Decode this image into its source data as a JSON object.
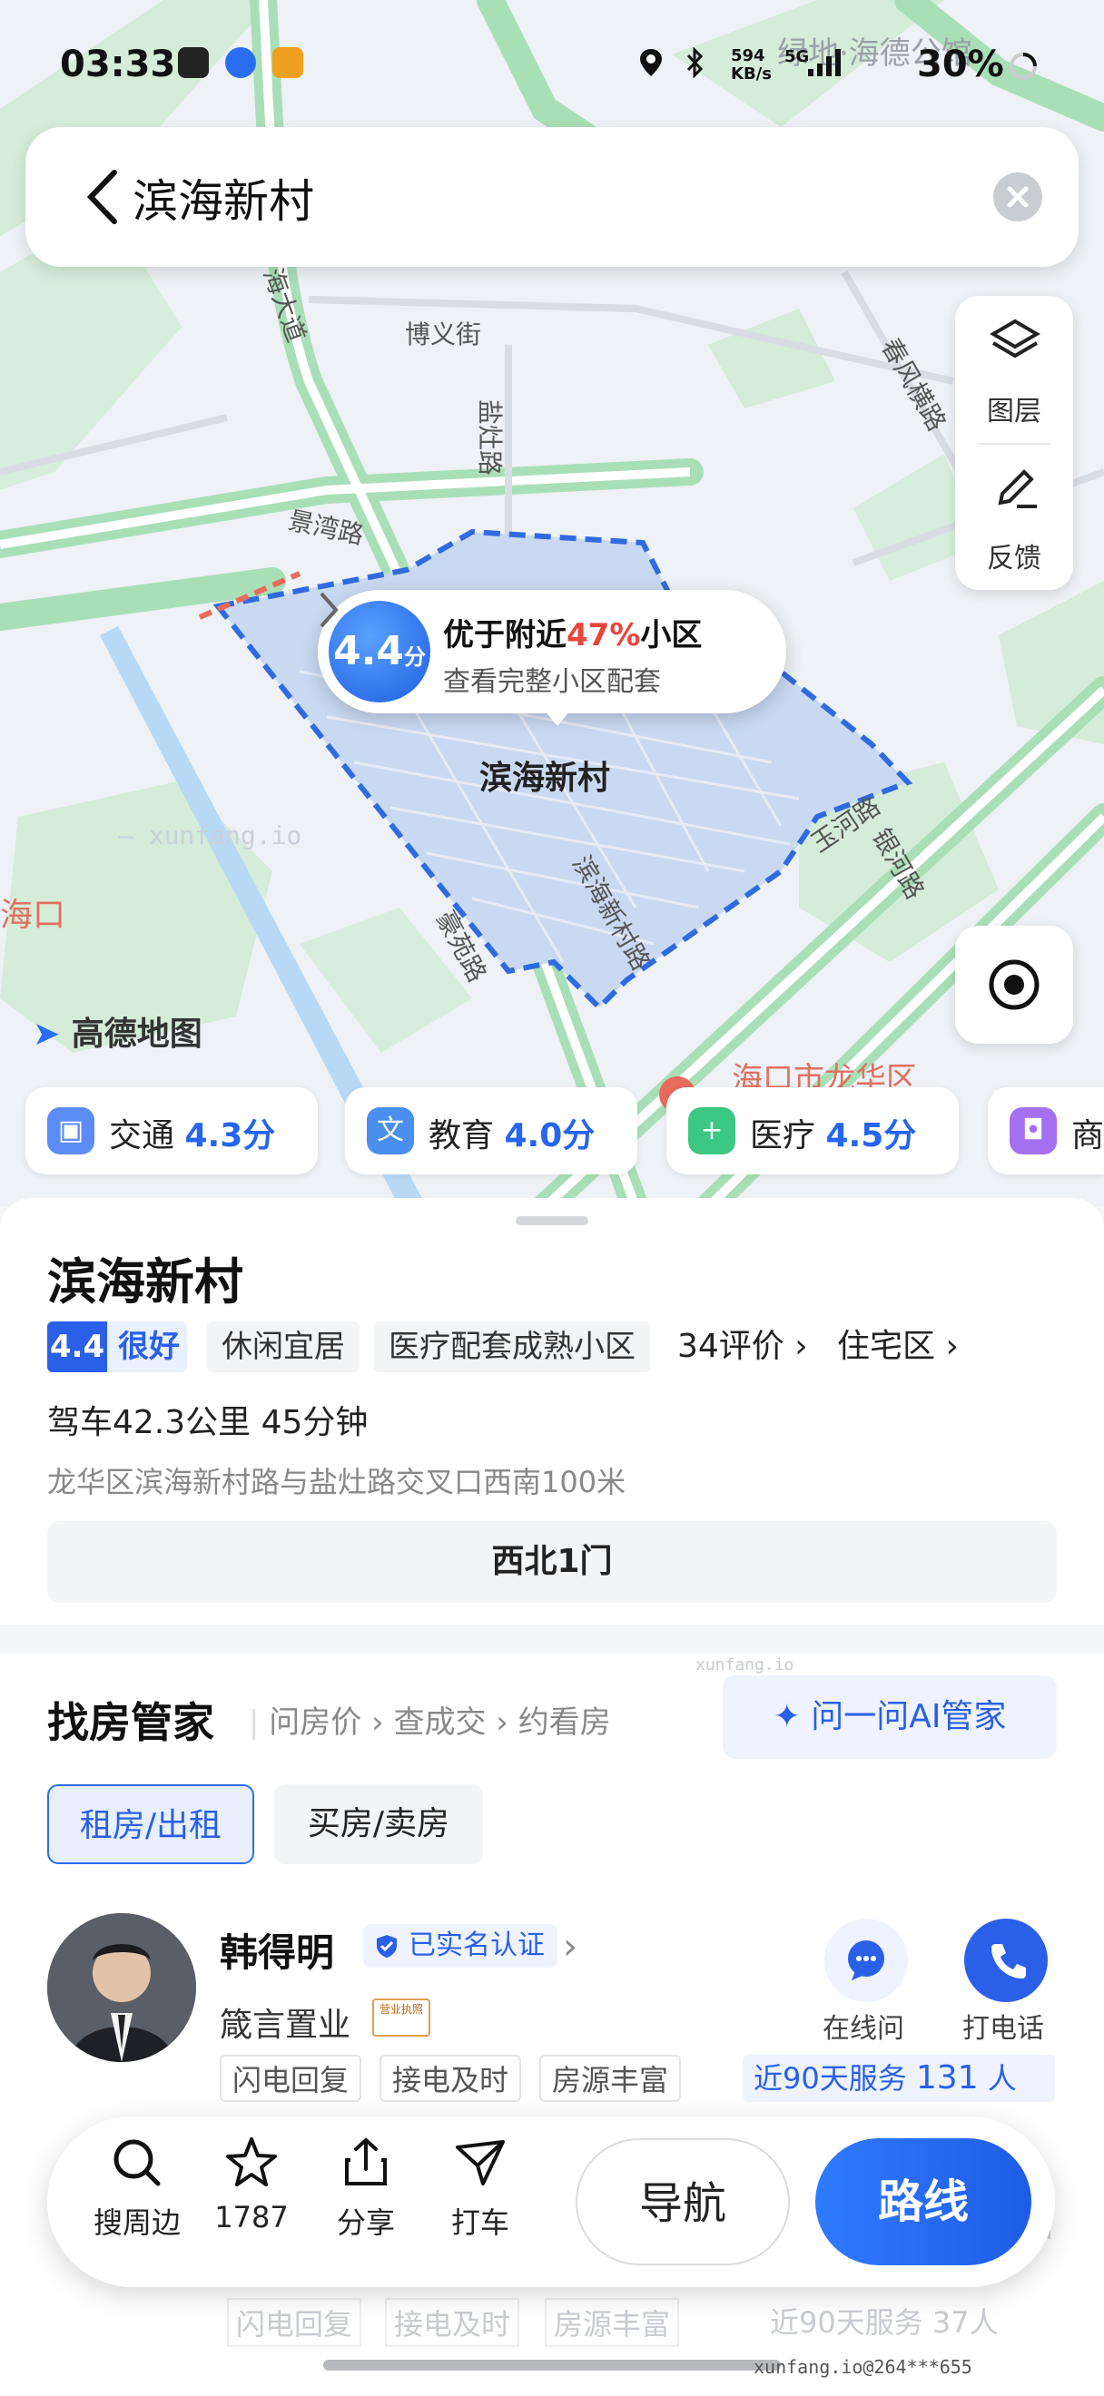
{
  "status_bar": {
    "time": "03:33",
    "net_speed": "594",
    "net_unit": "KB/s",
    "signal": "5G",
    "battery": "30%"
  },
  "search": {
    "title": "滨海新村"
  },
  "map": {
    "tools": {
      "layers_label": "图层",
      "feedback_label": "反馈"
    },
    "bubble": {
      "score": "4.4",
      "score_unit": "分",
      "prefix": "优于附近",
      "percent": "47%",
      "suffix": "小区",
      "subtitle": "查看完整小区配套"
    },
    "area_label": "滨海新村",
    "streets": [
      "博义街",
      "盐灶路",
      "景湾路",
      "春风横路",
      "滨海新村路",
      "豪苑路",
      "玉河路",
      "银河路",
      "海大道"
    ],
    "place_labels": [
      "绿地·海德公馆",
      "海口",
      "海口市龙华区"
    ],
    "watermark": "xunfang.io",
    "logo": "高德地图"
  },
  "chips": [
    {
      "icon": "train-icon",
      "label": "交通",
      "score": "4.3分",
      "color": "#5b8cf5"
    },
    {
      "icon": "education-icon",
      "label": "教育",
      "score": "4.0分",
      "color": "#4a8ef0"
    },
    {
      "icon": "medical-icon",
      "label": "医疗",
      "score": "4.5分",
      "color": "#3cc783"
    },
    {
      "icon": "shop-icon",
      "label": "商",
      "score": "",
      "color": "#a470f0"
    }
  ],
  "place": {
    "name": "滨海新村",
    "rating": "4.4",
    "rating_word": "很好",
    "tags": [
      "休闲宜居",
      "医疗配套成熟小区"
    ],
    "reviews": "34评价",
    "type": "住宅区",
    "drive": "驾车42.3公里 45分钟",
    "address": "龙华区滨海新村路与盐灶路交叉口西南100米",
    "gate": "西北1门"
  },
  "agent_section": {
    "title": "找房管家",
    "steps": [
      "问房价",
      "查成交",
      "约看房"
    ],
    "ai_button": "问一问AI管家",
    "tabs": [
      "租房/出租",
      "买房/卖房"
    ],
    "watermark": "xunfang.io",
    "agent": {
      "name": "韩得明",
      "verified": "已实名认证",
      "company": "箴言置业",
      "license_label": "营业执照",
      "tags": [
        "闪电回复",
        "接电及时",
        "房源丰富"
      ],
      "service_label": "近90天服务",
      "service_count": "131",
      "service_unit": "人",
      "online_label": "在线问",
      "call_label": "打电话"
    },
    "next_agent_tags": [
      "闪电回复",
      "接电及时",
      "房源丰富"
    ],
    "next_service": "近90天服务",
    "next_count": "37人",
    "next_call": "话"
  },
  "bottom_bar": {
    "nearby": "搜周边",
    "favorites": "1787",
    "share": "分享",
    "taxi": "打车",
    "navigate": "导航",
    "route": "路线"
  },
  "footer_watermark": "xunfang.io@264***655"
}
